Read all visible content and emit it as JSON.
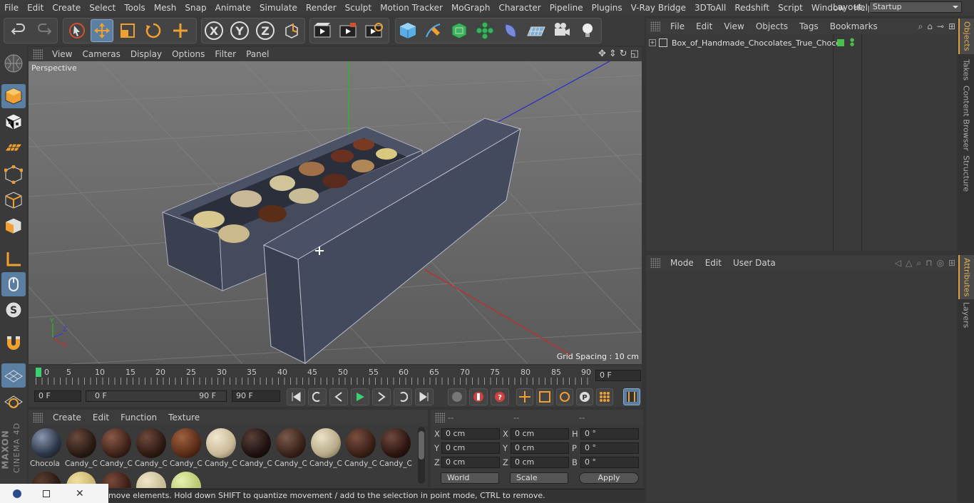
{
  "menu": [
    "File",
    "Edit",
    "Create",
    "Select",
    "Tools",
    "Mesh",
    "Snap",
    "Animate",
    "Simulate",
    "Render",
    "Sculpt",
    "Motion Tracker",
    "MoGraph",
    "Character",
    "Pipeline",
    "Plugins",
    "V-Ray Bridge",
    "3DToAll",
    "Redshift",
    "Script",
    "Window",
    "Help"
  ],
  "layout": {
    "label": "Layout:",
    "value": "Startup"
  },
  "axis_buttons": {
    "x": "X",
    "y": "Y",
    "z": "Z"
  },
  "viewport": {
    "menu": [
      "View",
      "Cameras",
      "Display",
      "Options",
      "Filter",
      "Panel"
    ],
    "camera_label": "Perspective",
    "grid_spacing": "Grid Spacing : 10 cm",
    "axis_x": "X",
    "axis_y": "Y",
    "axis_z": "Z"
  },
  "timeline": {
    "ticks": [
      "0",
      "5",
      "10",
      "15",
      "20",
      "25",
      "30",
      "35",
      "40",
      "45",
      "50",
      "55",
      "60",
      "65",
      "70",
      "75",
      "80",
      "85",
      "90"
    ],
    "current_frame": "0 F"
  },
  "transport": {
    "start_field": "0 F",
    "range_start": "0 F",
    "range_end": "90 F",
    "end_field": "90 F"
  },
  "materials": {
    "menu": [
      "Create",
      "Edit",
      "Function",
      "Texture"
    ],
    "items": [
      {
        "label": "Chocola",
        "color": "#2c3648"
      },
      {
        "label": "Candy_C",
        "color": "#2a1a14"
      },
      {
        "label": "Candy_C",
        "color": "#3e2219"
      },
      {
        "label": "Candy_C",
        "color": "#2e1a13"
      },
      {
        "label": "Candy_C",
        "color": "#5a2d18"
      },
      {
        "label": "Candy_C",
        "color": "#c8b898"
      },
      {
        "label": "Candy_C",
        "color": "#1e1210"
      },
      {
        "label": "Candy_C",
        "color": "#3a2219"
      },
      {
        "label": "Candy_C",
        "color": "#b8aa88"
      },
      {
        "label": "Candy_C",
        "color": "#3a2017"
      },
      {
        "label": "Candy_C",
        "color": "#2e1511"
      }
    ],
    "row2_colors": [
      "#2a1812",
      "#c9b470",
      "#3a1e16",
      "#c8bc96",
      "#b8c870"
    ]
  },
  "coords": {
    "headers": [
      "--",
      "--",
      "--"
    ],
    "rows": [
      {
        "l1": "X",
        "v1": "0 cm",
        "l2": "X",
        "v2": "0 cm",
        "l3": "H",
        "v3": "0 °"
      },
      {
        "l1": "Y",
        "v1": "0 cm",
        "l2": "Y",
        "v2": "0 cm",
        "l3": "P",
        "v3": "0 °"
      },
      {
        "l1": "Z",
        "v1": "0 cm",
        "l2": "Z",
        "v2": "0 cm",
        "l3": "B",
        "v3": "0 °"
      }
    ],
    "space": "World",
    "mode": "Scale",
    "apply": "Apply"
  },
  "objects": {
    "menu": [
      "File",
      "Edit",
      "View",
      "Objects",
      "Tags",
      "Bookmarks"
    ],
    "item": "Box_of_Handmade_Chocolates_True_Choco"
  },
  "attributes": {
    "menu": [
      "Mode",
      "Edit",
      "User Data"
    ]
  },
  "side_tabs": [
    "Objects",
    "Takes",
    "Content Browser",
    "Structure"
  ],
  "side_tabs2": [
    "Attributes",
    "Layers"
  ],
  "status": "move elements. Hold down SHIFT to quantize movement / add to the selection in point mode, CTRL to remove.",
  "brand": {
    "maxon": "MAXON",
    "cinema": "CINEMA 4D"
  }
}
